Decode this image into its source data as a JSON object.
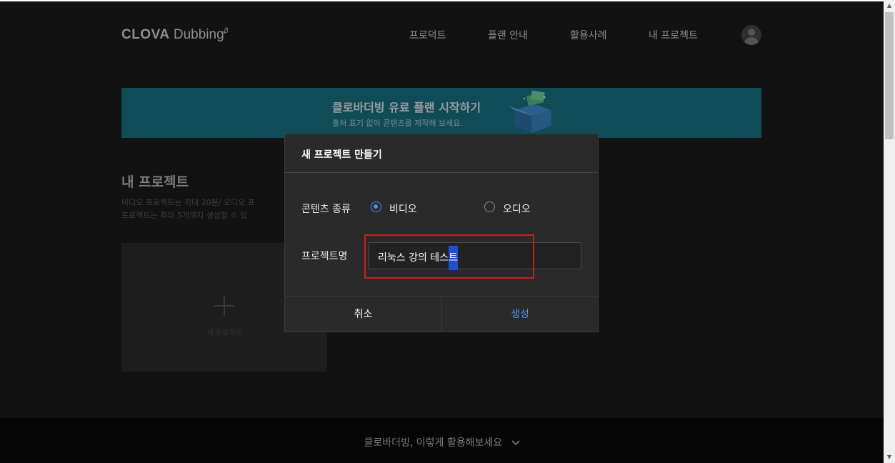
{
  "header": {
    "logo_brand": "CLOVA",
    "logo_product": "Dubbing",
    "logo_beta": "β",
    "nav": [
      {
        "label": "프로덕트"
      },
      {
        "label": "플랜 안내"
      },
      {
        "label": "활용사례"
      },
      {
        "label": "내 프로젝트"
      }
    ],
    "avatar_icon": "user-avatar-icon"
  },
  "banner": {
    "title": "클로바더빙 유료 플랜 시작하기",
    "subtitle": "출처 표기 없이 콘텐츠를 제작해 보세요.",
    "illustration_icon": "gift-box-icon",
    "color": "#0f4c57"
  },
  "projects": {
    "title": "내 프로젝트",
    "desc_line1": "비디오 프로젝트는 최대 20분/ 오디오 프",
    "desc_line2": "프로젝트는 최대 5개까지 생성할 수 있",
    "new_card_label": "새 프로젝트"
  },
  "dialog": {
    "title": "새 프로젝트 만들기",
    "content_type_label": "콘텐츠 종류",
    "options": [
      {
        "label": "비디오",
        "selected": true
      },
      {
        "label": "오디오",
        "selected": false
      }
    ],
    "name_label": "프로젝트명",
    "name_value_plain": "리눅스 강의 테스",
    "name_value_selected": "트",
    "cancel_label": "취소",
    "create_label": "생성",
    "accent_color": "#4d96f2",
    "highlight_color": "#cc1d1d"
  },
  "footer": {
    "text": "클로바더빙, 이렇게 활용해보세요",
    "chevron_icon": "chevron-down-icon"
  },
  "scrollbar": {
    "up_icon": "▲",
    "down_icon": "▼"
  }
}
